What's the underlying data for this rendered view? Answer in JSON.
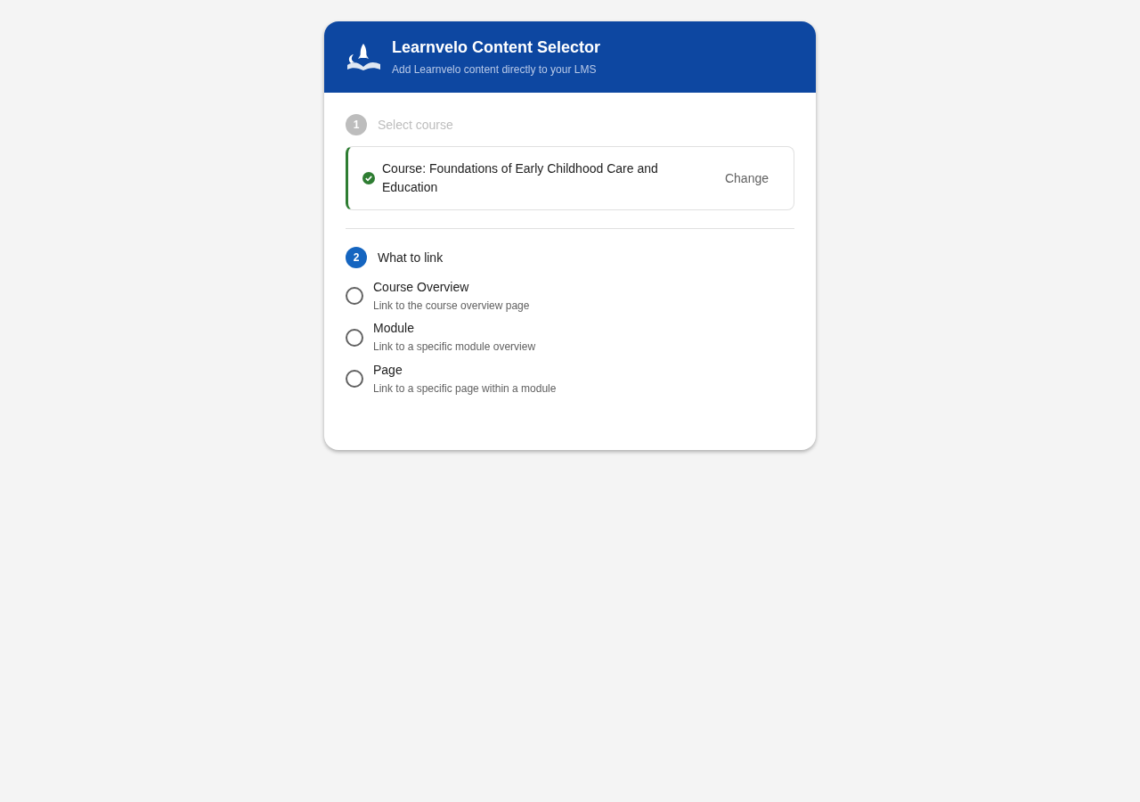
{
  "header": {
    "title": "Learnvelo Content Selector",
    "subtitle": "Add Learnvelo content directly to your LMS"
  },
  "steps": [
    {
      "number": "1",
      "label": "Select course",
      "active": false
    },
    {
      "number": "2",
      "label": "What to link",
      "active": true
    }
  ],
  "selected_course": {
    "text": "Course: Foundations of Early Childhood Care and Education",
    "confirmed": true,
    "action": "Change"
  },
  "options": [
    {
      "label": "Course Overview",
      "description": "Link to the course overview page",
      "selected": false
    },
    {
      "label": "Module",
      "description": "Link to a specific module overview",
      "selected": false
    },
    {
      "label": "Page",
      "description": "Link to a specific page within a module",
      "selected": false
    }
  ]
}
